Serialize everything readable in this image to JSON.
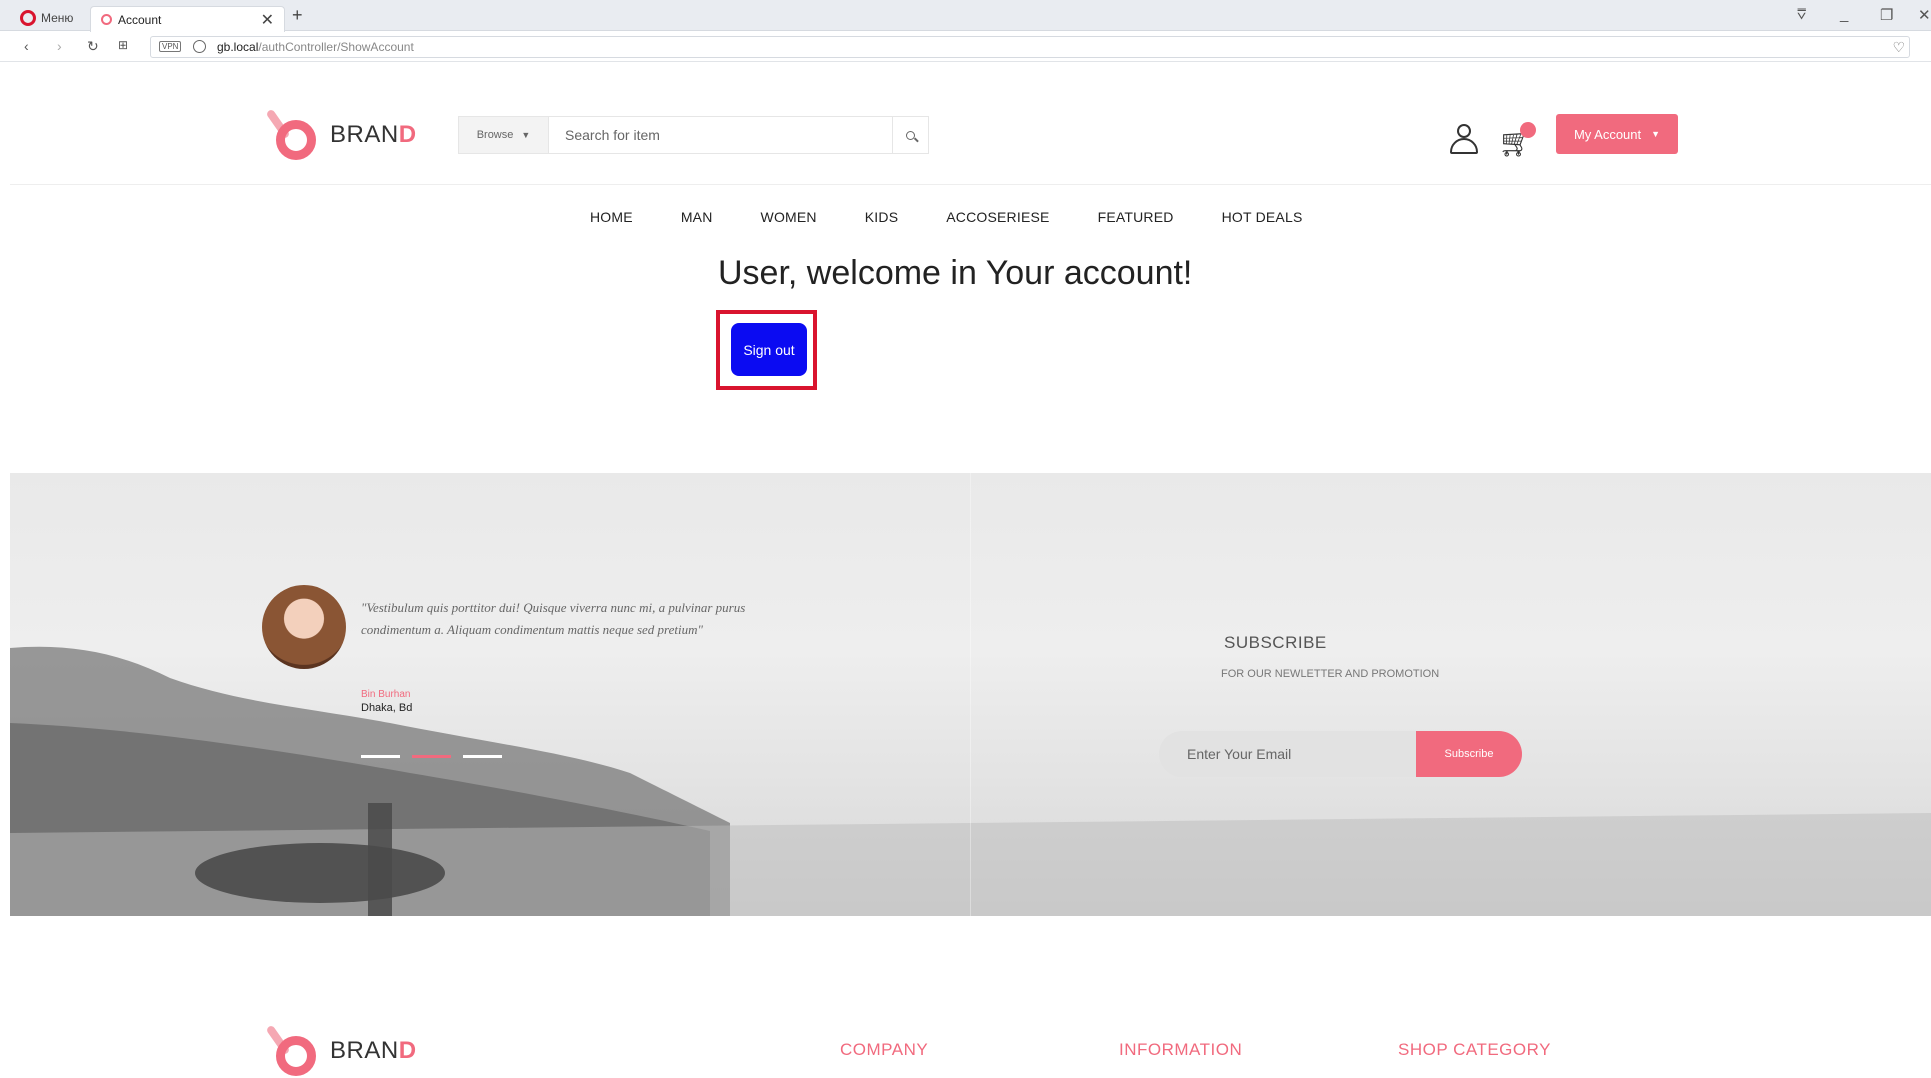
{
  "browser": {
    "menu_label": "Меню",
    "tab_title": "Account",
    "url_host": "gb.local",
    "url_path": "/authController/ShowAccount",
    "vpn_label": "VPN"
  },
  "header": {
    "brand_main": "BRAN",
    "brand_accent": "D",
    "browse_label": "Browse",
    "search_placeholder": "Search for item",
    "account_label": "My Account"
  },
  "nav": {
    "items": [
      "HOME",
      "MAN",
      "WOMEN",
      "KIDS",
      "ACCOSERIESE",
      "FEATURED",
      "HOT DEALS"
    ]
  },
  "main": {
    "welcome": "User, welcome in Your account!",
    "signout_label": "Sign out"
  },
  "testimonial": {
    "quote": "\"Vestibulum quis porttitor dui! Quisque viverra nunc mi, a pulvinar purus condimentum a. Aliquam condimentum mattis neque sed pretium\"",
    "author": "Bin Burhan",
    "location": "Dhaka, Bd"
  },
  "subscribe": {
    "title": "SUBSCRIBE",
    "subtitle": "FOR OUR NEWLETTER AND PROMOTION",
    "email_placeholder": "Enter Your Email",
    "button_label": "Subscribe"
  },
  "footer": {
    "columns": [
      "COMPANY",
      "INFORMATION",
      "SHOP CATEGORY"
    ]
  },
  "colors": {
    "accent": "#f16a7e",
    "signout_bg": "#0b0bf2",
    "highlight": "#d9142e"
  }
}
